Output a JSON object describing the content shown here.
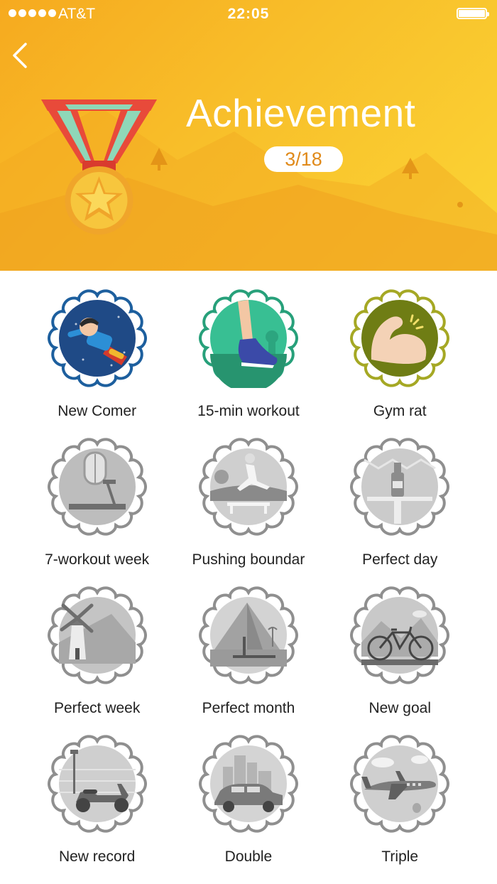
{
  "status_bar": {
    "carrier": "AT&T",
    "time": "22:05"
  },
  "header": {
    "title": "Achievement",
    "progress": "3/18",
    "gradient": [
      "#f6aa1f",
      "#fbd535"
    ]
  },
  "icons": {
    "back": "chevron-left-icon",
    "medal": "gold-medal-icon"
  },
  "badges": [
    {
      "label": "New Comer",
      "icon": "superhero-icon",
      "unlocked": true,
      "color": "#1d4f8c"
    },
    {
      "label": "15-min workout",
      "icon": "running-shoe-icon",
      "unlocked": true,
      "color": "#2fb389"
    },
    {
      "label": "Gym rat",
      "icon": "flexed-bicep-icon",
      "unlocked": true,
      "color": "#9a9d1c"
    },
    {
      "label": "7-workout week",
      "icon": "treadmill-icon",
      "unlocked": false
    },
    {
      "label": "Pushing boundar",
      "icon": "hurdle-runner-icon",
      "unlocked": false
    },
    {
      "label": "Perfect day",
      "icon": "wine-bottle-icon",
      "unlocked": false
    },
    {
      "label": "Perfect week",
      "icon": "windmill-icon",
      "unlocked": false
    },
    {
      "label": "Perfect month",
      "icon": "pyramid-icon",
      "unlocked": false
    },
    {
      "label": "New goal",
      "icon": "bicycle-icon",
      "unlocked": false
    },
    {
      "label": "New record",
      "icon": "scooter-icon",
      "unlocked": false
    },
    {
      "label": "Double",
      "icon": "car-city-icon",
      "unlocked": false
    },
    {
      "label": "Triple",
      "icon": "airplane-icon",
      "unlocked": false
    }
  ]
}
